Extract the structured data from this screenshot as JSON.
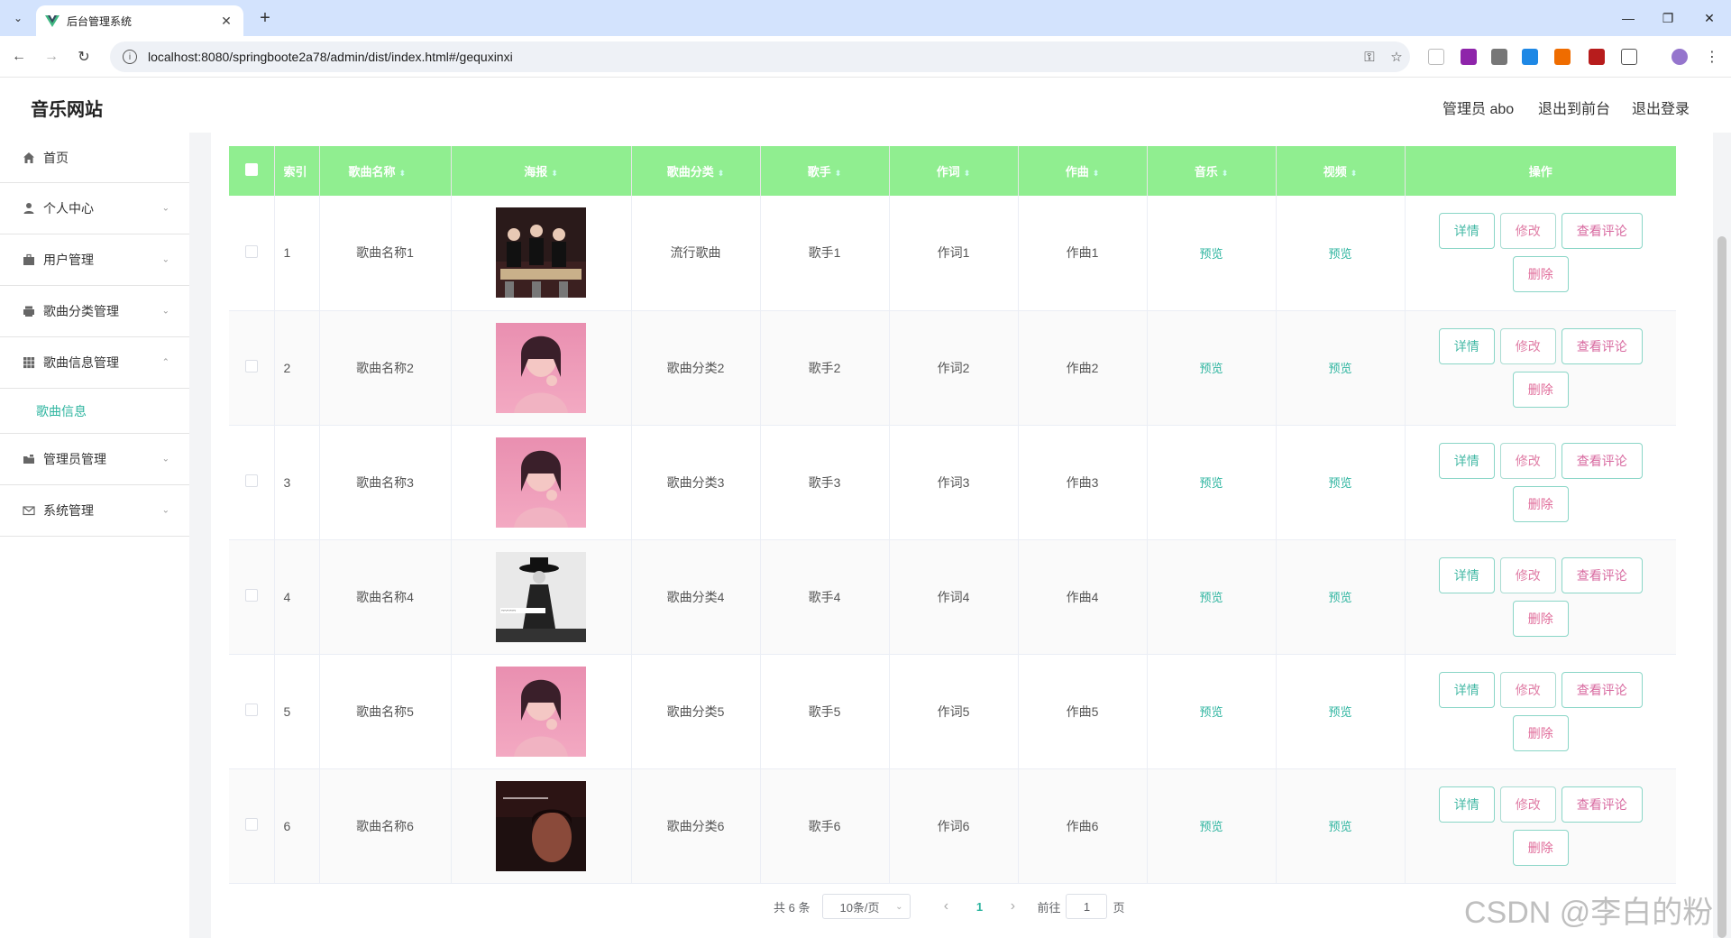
{
  "browser": {
    "tab_title": "后台管理系统",
    "url": "localhost:8080/springboote2a78/admin/dist/index.html#/gequxinxi"
  },
  "header": {
    "app_title": "音乐网站",
    "admin_label": "管理员 abo",
    "to_front_label": "退出到前台",
    "logout_label": "退出登录"
  },
  "sidebar": {
    "items": [
      {
        "label": "首页",
        "icon": "home-icon"
      },
      {
        "label": "个人中心",
        "icon": "user-icon"
      },
      {
        "label": "用户管理",
        "icon": "briefcase-icon"
      },
      {
        "label": "歌曲分类管理",
        "icon": "printer-icon"
      },
      {
        "label": "歌曲信息管理",
        "icon": "grid-icon"
      },
      {
        "label": "管理员管理",
        "icon": "folder-icon"
      },
      {
        "label": "系统管理",
        "icon": "mail-icon"
      }
    ],
    "active_sub": "歌曲信息"
  },
  "table": {
    "headers": [
      "索引",
      "歌曲名称",
      "海报",
      "歌曲分类",
      "歌手",
      "作词",
      "作曲",
      "音乐",
      "视频",
      "操作"
    ],
    "rows": [
      {
        "index": "1",
        "name": "歌曲名称1",
        "category": "流行歌曲",
        "singer": "歌手1",
        "lyricist": "作词1",
        "composer": "作曲1",
        "music": "预览",
        "video": "预览",
        "poster": "band-poster"
      },
      {
        "index": "2",
        "name": "歌曲名称2",
        "category": "歌曲分类2",
        "singer": "歌手2",
        "lyricist": "作词2",
        "composer": "作曲2",
        "music": "预览",
        "video": "预览",
        "poster": "pink-portrait-poster"
      },
      {
        "index": "3",
        "name": "歌曲名称3",
        "category": "歌曲分类3",
        "singer": "歌手3",
        "lyricist": "作词3",
        "composer": "作曲3",
        "music": "预览",
        "video": "预览",
        "poster": "pink-portrait-poster"
      },
      {
        "index": "4",
        "name": "歌曲名称4",
        "category": "歌曲分类4",
        "singer": "歌手4",
        "lyricist": "作词4",
        "composer": "作曲4",
        "music": "预览",
        "video": "预览",
        "poster": "hat-figure-poster"
      },
      {
        "index": "5",
        "name": "歌曲名称5",
        "category": "歌曲分类5",
        "singer": "歌手5",
        "lyricist": "作词5",
        "composer": "作曲5",
        "music": "预览",
        "video": "预览",
        "poster": "pink-portrait-poster"
      },
      {
        "index": "6",
        "name": "歌曲名称6",
        "category": "歌曲分类6",
        "singer": "歌手6",
        "lyricist": "作词6",
        "composer": "作曲6",
        "music": "预览",
        "video": "预览",
        "poster": "dark-portrait-poster"
      }
    ],
    "actions": {
      "detail": "详情",
      "edit": "修改",
      "comment": "查看评论",
      "delete": "删除"
    }
  },
  "pagination": {
    "total": "共 6 条",
    "page_size": "10条/页",
    "current_page": "1",
    "goto_prefix": "前往",
    "goto_value": "1",
    "goto_suffix": "页"
  },
  "watermark": "CSDN @李白的粉",
  "colors": {
    "header_bg": "#90ee90",
    "accent": "#2fb5a0",
    "pink": "#e07ea6"
  }
}
